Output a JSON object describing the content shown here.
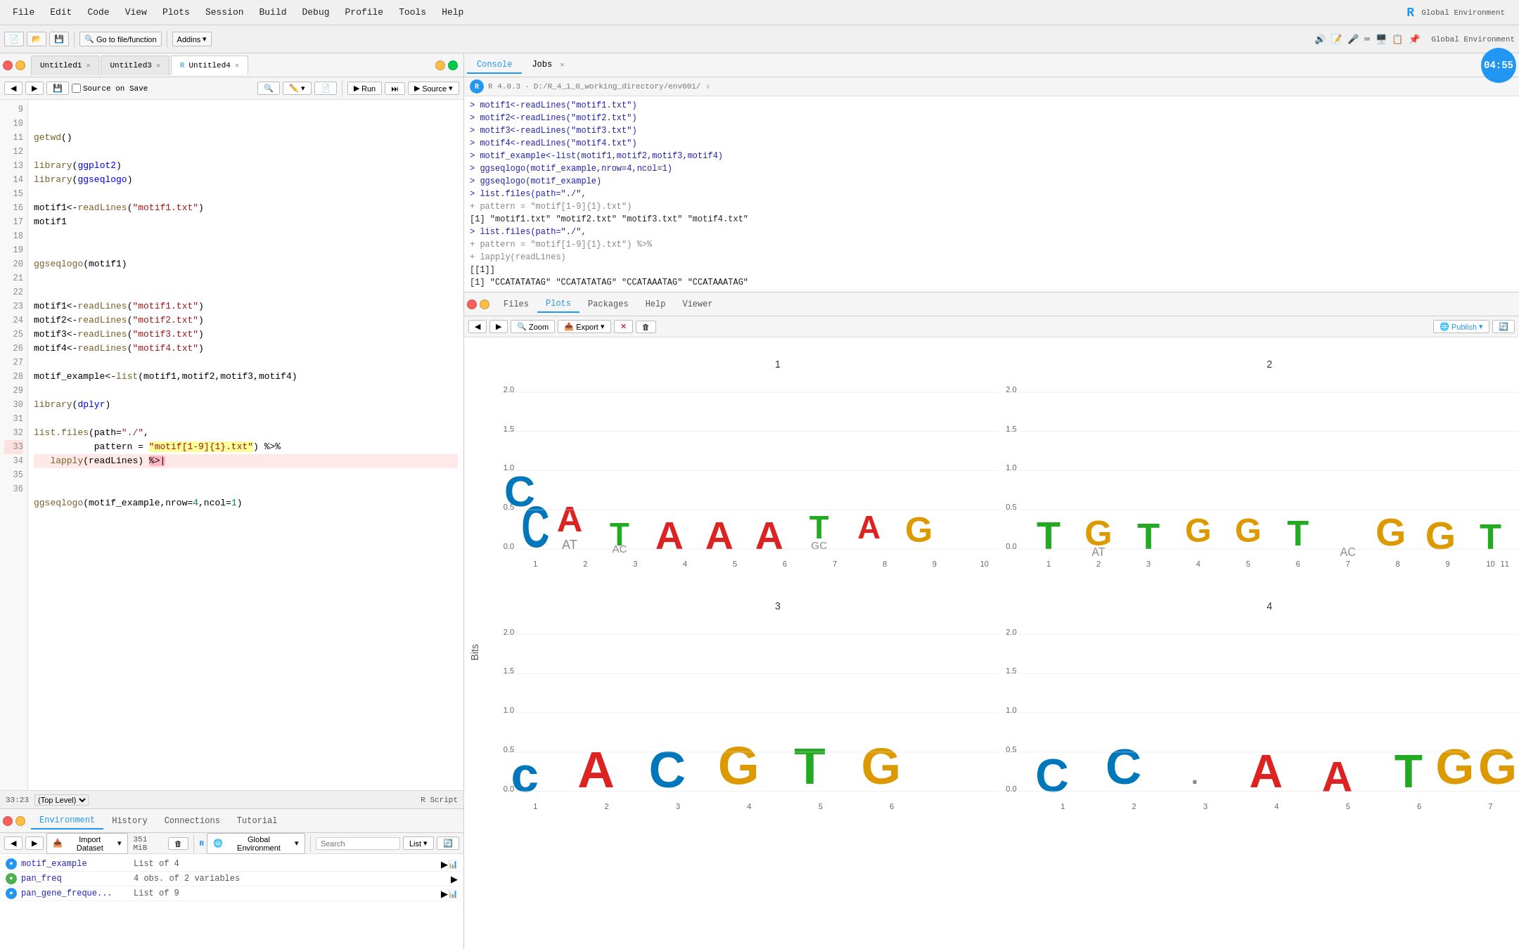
{
  "menubar": {
    "items": [
      "File",
      "Edit",
      "Code",
      "View",
      "Plots",
      "Session",
      "Build",
      "Debug",
      "Profile",
      "Tools",
      "Help"
    ]
  },
  "tabs": {
    "editor": [
      {
        "label": "Untitled1",
        "active": false
      },
      {
        "label": "Untitled3",
        "active": false
      },
      {
        "label": "Untitled4",
        "active": true
      }
    ]
  },
  "editor": {
    "run_label": "Run",
    "source_label": "Source",
    "source_on_save_label": "Source on Save",
    "status": "33:23",
    "scope": "(Top Level)",
    "file_type": "R Script"
  },
  "console": {
    "tabs": [
      "Console",
      "Jobs"
    ],
    "active_tab": "Console",
    "r_version": "R 4.0.3",
    "working_dir": "D:/R_4_1_0_working_directory/env001/",
    "timer": "04:55",
    "lines": [
      "> motif1<-readLines(\"motif1.txt\")",
      "> motif2<-readLines(\"motif2.txt\")",
      "> motif3<-readLines(\"motif3.txt\")",
      "> motif4<-readLines(\"motif4.txt\")",
      "> motif_example<-list(motif1,motif2,motif3,motif4)",
      "> ggseqlogo(motif_example,nrow=4,ncol=1)",
      "> ggseqlogo(motif_example)",
      "> list.files(path=\"./\",",
      "+            pattern = \"motif[1-9]{1}.txt\")",
      "[1] \"motif1.txt\" \"motif2.txt\" \"motif3.txt\" \"motif4.txt\"",
      "> list.files(path=\"./\",",
      "+            pattern = \"motif[1-9]{1}.txt\") %>%",
      "+   lapply(readLines)",
      "[[1]]",
      "[1] \"CCATATATAG\" \"CCATATATAG\" \"CCATAAATAG\" \"CCATAAATAG\""
    ]
  },
  "viewer": {
    "tabs": [
      "Files",
      "Plots",
      "Packages",
      "Help",
      "Viewer"
    ],
    "active_tab": "Viewer",
    "zoom_label": "Zoom",
    "export_label": "Export",
    "publish_label": "Publish",
    "plot_labels": [
      "1",
      "2",
      "3",
      "4"
    ],
    "y_axis_label": "Bits"
  },
  "environment": {
    "tabs": [
      "Environment",
      "History",
      "Connections",
      "Tutorial"
    ],
    "active_tab": "Environment",
    "history_tab": "History",
    "memory": "351 MiB",
    "import_label": "Import Dataset",
    "list_label": "List",
    "scope": "Global Environment",
    "r_label": "R",
    "variables": [
      {
        "name": "motif_example",
        "value": "List of  4"
      },
      {
        "name": "pan_freq",
        "value": "4 obs. of 2 variables"
      },
      {
        "name": "pan_gene_freque...",
        "value": "List of  9"
      }
    ]
  },
  "code_lines": [
    {
      "num": 9,
      "code": ""
    },
    {
      "num": 10,
      "code": "getwd()"
    },
    {
      "num": 11,
      "code": ""
    },
    {
      "num": 12,
      "code": "library(ggplot2)"
    },
    {
      "num": 13,
      "code": "library(ggseqlogo)"
    },
    {
      "num": 14,
      "code": ""
    },
    {
      "num": 15,
      "code": "motif1<-readLines(\"motif1.txt\")"
    },
    {
      "num": 16,
      "code": "motif1"
    },
    {
      "num": 17,
      "code": ""
    },
    {
      "num": 18,
      "code": ""
    },
    {
      "num": 19,
      "code": "ggseqlogo(motif1)"
    },
    {
      "num": 20,
      "code": ""
    },
    {
      "num": 21,
      "code": ""
    },
    {
      "num": 22,
      "code": "motif1<-readLines(\"motif1.txt\")"
    },
    {
      "num": 23,
      "code": "motif2<-readLines(\"motif2.txt\")"
    },
    {
      "num": 24,
      "code": "motif3<-readLines(\"motif3.txt\")"
    },
    {
      "num": 25,
      "code": "motif4<-readLines(\"motif4.txt\")"
    },
    {
      "num": 26,
      "code": ""
    },
    {
      "num": 27,
      "code": "motif_example<-list(motif1,motif2,motif3,motif4)"
    },
    {
      "num": 28,
      "code": ""
    },
    {
      "num": 29,
      "code": "library(dplyr)"
    },
    {
      "num": 30,
      "code": ""
    },
    {
      "num": 31,
      "code": "list.files(path=\"./\","
    },
    {
      "num": 32,
      "code": "           pattern = \"motif[1-9]{1}.txt\") %>%"
    },
    {
      "num": 33,
      "code": "  lapply(readLines) %>|"
    },
    {
      "num": 34,
      "code": ""
    },
    {
      "num": 35,
      "code": "ggseqlogo(motif_example,nrow=4,ncol=1)"
    },
    {
      "num": 36,
      "code": ""
    }
  ]
}
